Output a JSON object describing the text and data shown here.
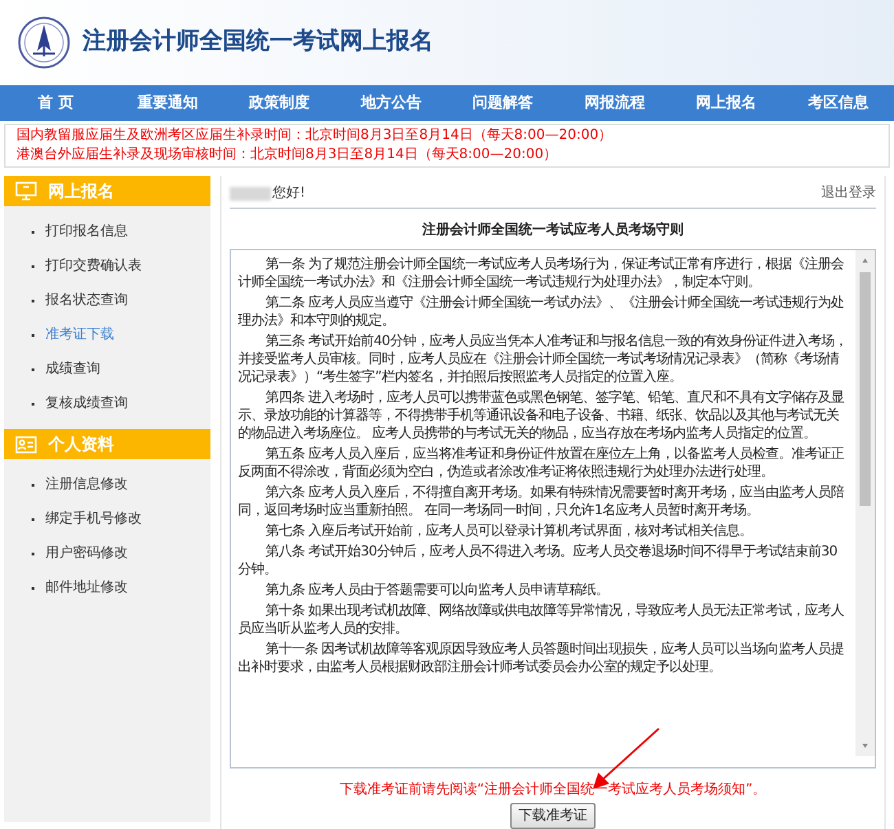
{
  "header": {
    "title": "注册会计师全国统一考试网上报名"
  },
  "nav": [
    "首 页",
    "重要通知",
    "政策制度",
    "地方公告",
    "问题解答",
    "网报流程",
    "网上报名",
    "考区信息"
  ],
  "notices": [
    "国内教留服应届生及欧洲考区应届生补录时间：北京时间8月3日至8月14日（每天8:00—20:00）",
    "港澳台外应届生补录及现场审核时间：北京时间8月3日至8月14日（每天8:00—20:00）"
  ],
  "sidebar": [
    {
      "title": "网上报名",
      "kind": "monitor",
      "items": [
        {
          "label": "打印报名信息",
          "selected": false
        },
        {
          "label": "打印交费确认表",
          "selected": false
        },
        {
          "label": "报名状态查询",
          "selected": false
        },
        {
          "label": "准考证下载",
          "selected": true
        },
        {
          "label": "成绩查询",
          "selected": false
        },
        {
          "label": "复核成绩查询",
          "selected": false
        }
      ]
    },
    {
      "title": "个人资料",
      "kind": "card",
      "items": [
        {
          "label": "注册信息修改",
          "selected": false
        },
        {
          "label": "绑定手机号修改",
          "selected": false
        },
        {
          "label": "用户密码修改",
          "selected": false
        },
        {
          "label": "邮件地址修改",
          "selected": false
        }
      ]
    }
  ],
  "greeting": "您好!",
  "logout": "退出登录",
  "rules": {
    "title": "注册会计师全国统一考试应考人员考场守则",
    "paragraphs": [
      "第一条 为了规范注册会计师全国统一考试应考人员考场行为，保证考试正常有序进行，根据《注册会计师全国统一考试办法》和《注册会计师全国统一考试违规行为处理办法》，制定本守则。",
      "第二条 应考人员应当遵守《注册会计师全国统一考试办法》、《注册会计师全国统一考试违规行为处理办法》和本守则的规定。",
      "第三条 考试开始前40分钟，应考人员应当凭本人准考证和与报名信息一致的有效身份证件进入考场，并接受监考人员审核。同时，应考人员应在《注册会计师全国统一考试考场情况记录表》（简称《考场情况记录表》）“考生签字”栏内签名，并拍照后按照监考人员指定的位置入座。",
      "第四条 进入考场时，应考人员可以携带蓝色或黑色钢笔、签字笔、铅笔、直尺和不具有文字储存及显示、录放功能的计算器等，不得携带手机等通讯设备和电子设备、书籍、纸张、饮品以及其他与考试无关的物品进入考场座位。 应考人员携带的与考试无关的物品，应当存放在考场内监考人员指定的位置。",
      "第五条 应考人员入座后，应当将准考证和身份证件放置在座位左上角，以备监考人员检查。准考证正反两面不得涂改，背面必须为空白，伪造或者涂改准考证将依照违规行为处理办法进行处理。",
      "第六条 应考人员入座后，不得擅自离开考场。如果有特殊情况需要暂时离开考场，应当由监考人员陪同，返回考场时应当重新拍照。 在同一考场同一时间，只允许1名应考人员暂时离开考场。",
      "第七条 入座后考试开始前，应考人员可以登录计算机考试界面，核对考试相关信息。",
      "第八条 考试开始30分钟后，应考人员不得进入考场。应考人员交卷退场时间不得早于考试结束前30分钟。",
      "第九条 应考人员由于答题需要可以向监考人员申请草稿纸。",
      "第十条 如果出现考试机故障、网络故障或供电故障等异常情况，导致应考人员无法正常考试，应考人员应当听从监考人员的安排。",
      "第十一条 因考试机故障等客观原因导致应考人员答题时间出现损失，应考人员可以当场向监考人员提出补时要求，由监考人员根据财政部注册会计师考试委员会办公室的规定予以处理。"
    ]
  },
  "warning": "下载准考证前请先阅读“注册会计师全国统一考试应考人员考场须知”。",
  "download_button": "下载准考证"
}
